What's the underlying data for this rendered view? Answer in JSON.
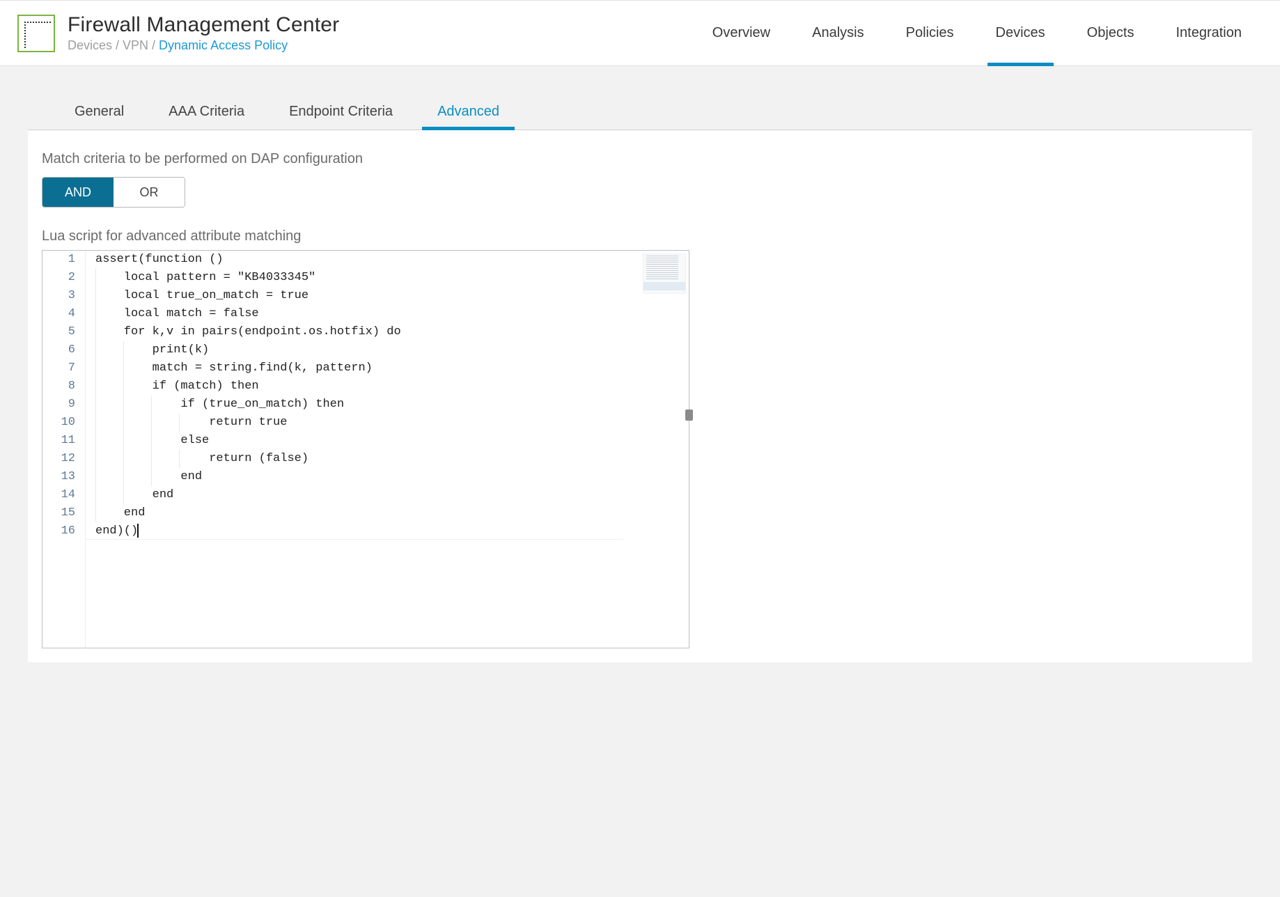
{
  "header": {
    "title": "Firewall Management Center",
    "breadcrumb_prefix": "Devices / VPN / ",
    "breadcrumb_current": "Dynamic Access Policy",
    "nav": [
      {
        "label": "Overview",
        "active": false
      },
      {
        "label": "Analysis",
        "active": false
      },
      {
        "label": "Policies",
        "active": false
      },
      {
        "label": "Devices",
        "active": true
      },
      {
        "label": "Objects",
        "active": false
      },
      {
        "label": "Integration",
        "active": false
      }
    ]
  },
  "subtabs": [
    {
      "label": "General",
      "active": false
    },
    {
      "label": "AAA Criteria",
      "active": false
    },
    {
      "label": "Endpoint Criteria",
      "active": false
    },
    {
      "label": "Advanced",
      "active": true
    }
  ],
  "panel": {
    "match_label": "Match criteria to be performed on DAP configuration",
    "toggle": {
      "and": "AND",
      "or": "OR",
      "active": "and"
    },
    "script_label": "Lua script for advanced attribute matching",
    "code_lines": [
      {
        "indent": 0,
        "text": "assert(function ()"
      },
      {
        "indent": 1,
        "text": "local pattern = \"KB4033345\""
      },
      {
        "indent": 1,
        "text": "local true_on_match = true"
      },
      {
        "indent": 1,
        "text": "local match = false"
      },
      {
        "indent": 1,
        "text": "for k,v in pairs(endpoint.os.hotfix) do"
      },
      {
        "indent": 2,
        "text": "print(k)"
      },
      {
        "indent": 2,
        "text": "match = string.find(k, pattern)"
      },
      {
        "indent": 2,
        "text": "if (match) then"
      },
      {
        "indent": 3,
        "text": "if (true_on_match) then"
      },
      {
        "indent": 4,
        "text": "return true"
      },
      {
        "indent": 3,
        "text": "else"
      },
      {
        "indent": 4,
        "text": "return (false)"
      },
      {
        "indent": 3,
        "text": "end"
      },
      {
        "indent": 2,
        "text": "end"
      },
      {
        "indent": 1,
        "text": "end"
      },
      {
        "indent": 0,
        "text": "end)()"
      }
    ]
  }
}
